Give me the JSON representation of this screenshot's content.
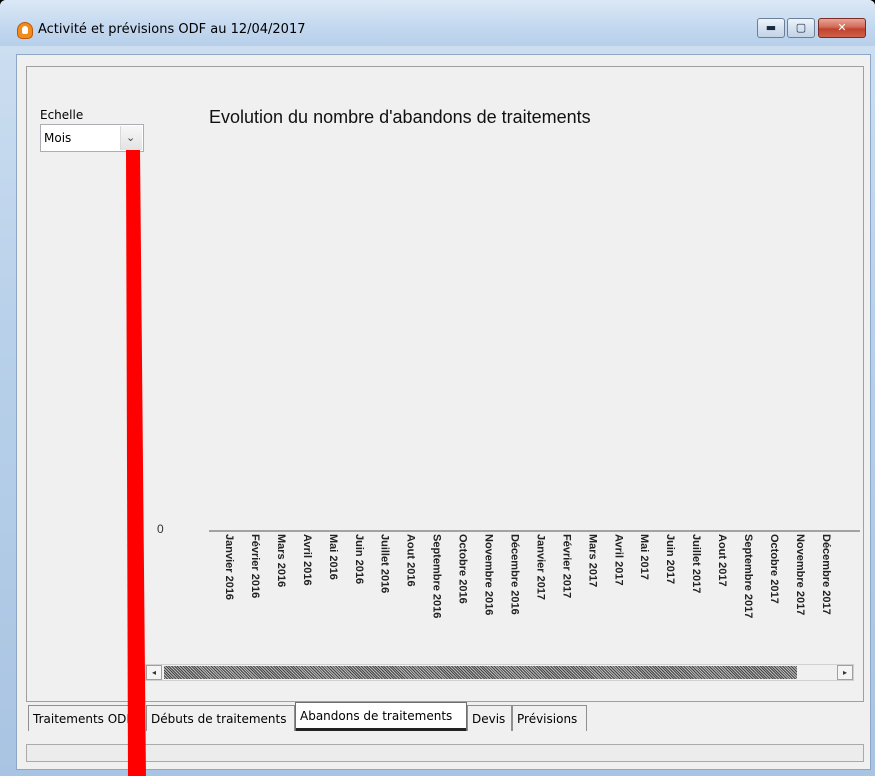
{
  "window": {
    "title": "Activité et prévisions ODF au 12/04/2017",
    "minimize_glyph": "▬",
    "maximize_glyph": "▢",
    "close_glyph": "✕"
  },
  "controls": {
    "echelle_label": "Echelle",
    "echelle_value": "Mois",
    "echelle_arrow_glyph": "⌄"
  },
  "chart_data": {
    "type": "bar",
    "title": "Evolution du nombre d'abandons de traitements",
    "xlabel": "",
    "ylabel": "",
    "y_tick_label": "0",
    "categories": [
      "Janvier 2016",
      "Février 2016",
      "Mars 2016",
      "Avril 2016",
      "Mai 2016",
      "Juin 2016",
      "Juillet 2016",
      "Aout 2016",
      "Septembre 2016",
      "Octobre 2016",
      "Novembre 2016",
      "Décembre 2016",
      "Janvier 2017",
      "Février 2017",
      "Mars 2017",
      "Avril 2017",
      "Mai 2017",
      "Juin 2017",
      "Juillet 2017",
      "Aout 2017",
      "Septembre 2017",
      "Octobre 2017",
      "Novembre 2017",
      "Décembre 2017"
    ],
    "values": [
      0,
      0,
      0,
      0,
      0,
      0,
      0,
      0,
      0,
      0,
      0,
      0,
      0,
      0,
      0,
      0,
      0,
      0,
      0,
      0,
      0,
      0,
      0,
      0
    ]
  },
  "scrollbar": {
    "left_glyph": "◂",
    "right_glyph": "▸"
  },
  "tabs": [
    {
      "label": "Traitements ODF",
      "active": false
    },
    {
      "label": "Débuts de traitements",
      "active": false
    },
    {
      "label": "Abandons de traitements",
      "active": true
    },
    {
      "label": "Devis",
      "active": false
    },
    {
      "label": "Prévisions",
      "active": false
    }
  ],
  "colors": {
    "annotation_arrow": "#ff0000",
    "accent_close": "#c0432f"
  }
}
